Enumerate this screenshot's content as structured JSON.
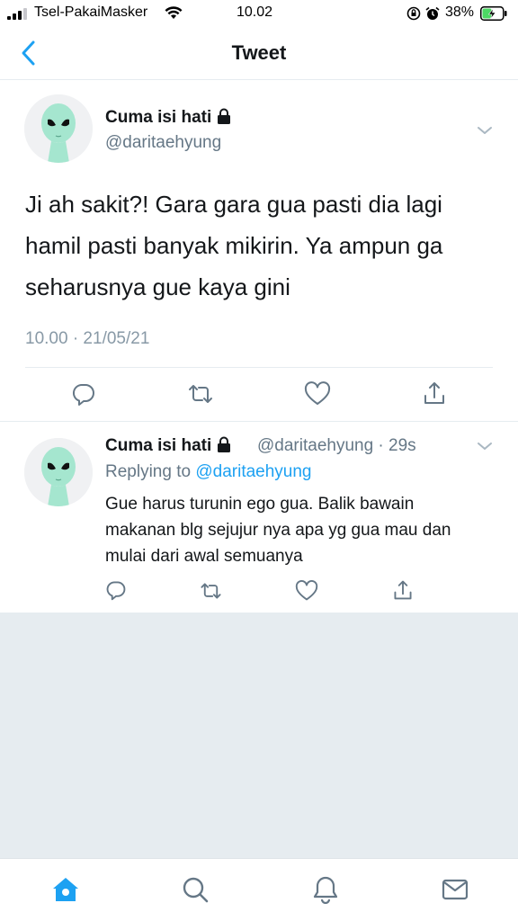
{
  "status_bar": {
    "carrier": "Tsel-PakaiMasker",
    "time": "10.02",
    "battery": "38%"
  },
  "nav": {
    "title": "Tweet",
    "back_icon": "chevron-left-icon"
  },
  "main_tweet": {
    "display_name": "Cuma isi hati",
    "handle": "@daritaehyung",
    "text": "Ji ah sakit?! Gara gara gua pasti dia lagi hamil pasti banyak mikirin. Ya ampun ga seharusnya gue kaya gini",
    "timestamp": "10.00 · 21/05/21",
    "actions": [
      "reply-icon",
      "retweet-icon",
      "like-icon",
      "share-icon"
    ]
  },
  "reply_tweet": {
    "display_name": "Cuma isi hati",
    "meta": "@daritaehyung · 29s",
    "replying_prefix": "Replying to ",
    "replying_to": "@daritaehyung",
    "text": "Gue harus turunin ego gua. Balik bawain makanan blg sejujur nya apa yg gua mau dan mulai dari awal semuanya",
    "actions": [
      "reply-icon",
      "retweet-icon",
      "like-icon",
      "share-icon"
    ]
  },
  "tab_bar": {
    "tabs": [
      "home-icon",
      "search-icon",
      "notifications-icon",
      "messages-icon"
    ],
    "active": "home-icon"
  },
  "colors": {
    "accent": "#1da1f2",
    "secondary_text": "#657786",
    "divider": "#e6ecf0",
    "battery_fill": "#4cd964"
  }
}
